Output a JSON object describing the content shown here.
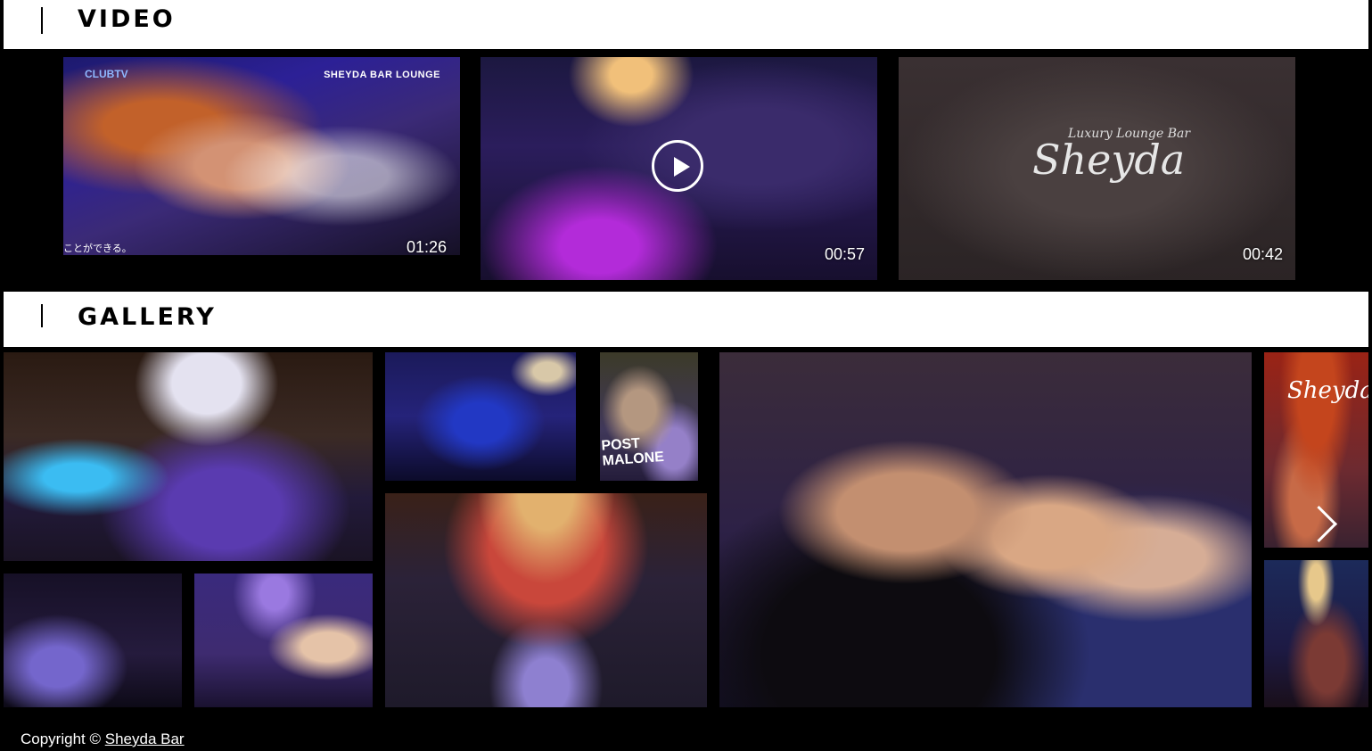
{
  "video_section": {
    "title": "VIDEO",
    "videos": [
      {
        "duration": "01:26",
        "overlay_left": "CLUBTV",
        "overlay_right": "SHEYDA BAR LOUNGE",
        "caption": "ことができる。"
      },
      {
        "duration": "00:57",
        "icon": "play-icon"
      },
      {
        "duration": "00:42",
        "logo_small": "Luxury Lounge Bar",
        "logo_big": "Sheyda"
      }
    ]
  },
  "gallery_section": {
    "title": "GALLERY",
    "photo_texts": {
      "post_malone": "POST MALONE",
      "sheyda_logo": "Sheyda"
    },
    "next_icon": "chevron-right-icon"
  },
  "footer": {
    "prefix": "Copyright ©",
    "link_label": "Sheyda Bar"
  }
}
